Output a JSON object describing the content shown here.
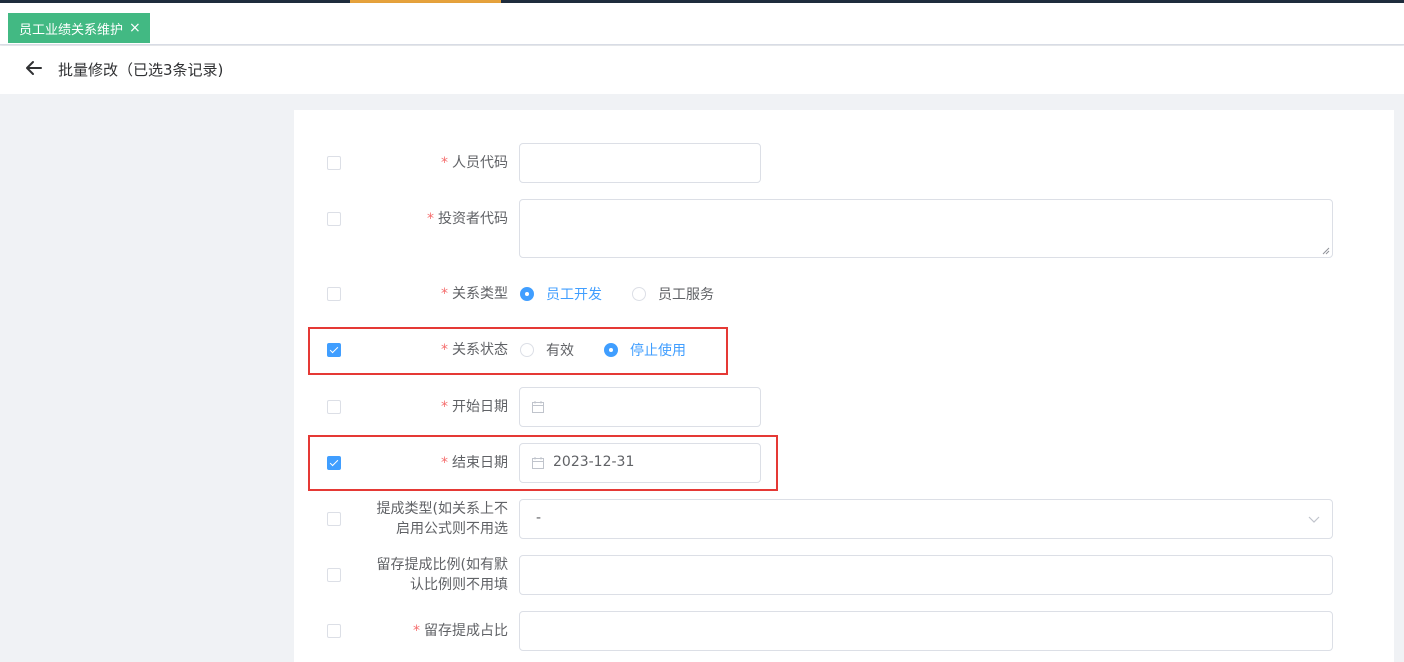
{
  "tabs": [
    {
      "label": "员工业绩关系维护",
      "close": "×"
    }
  ],
  "header": {
    "title": "批量修改（已选3条记录)"
  },
  "form": {
    "fields": [
      {
        "label": "人员代码",
        "required": "*",
        "checked": false
      },
      {
        "label": "投资者代码",
        "required": "*",
        "checked": false
      },
      {
        "label": "关系类型",
        "required": "*",
        "checked": false,
        "options": [
          "员工开发",
          "员工服务"
        ],
        "selected": "员工开发"
      },
      {
        "label": "关系状态",
        "required": "*",
        "checked": true,
        "options": [
          "有效",
          "停止使用"
        ],
        "selected": "停止使用"
      },
      {
        "label": "开始日期",
        "required": "*",
        "checked": false,
        "value": ""
      },
      {
        "label": "结束日期",
        "required": "*",
        "checked": true,
        "value": "2023-12-31"
      },
      {
        "label_line1": "提成类型(如关系上不",
        "label_line2": "启用公式则不用选",
        "checked": false,
        "value": "-"
      },
      {
        "label_line1": "留存提成比例(如有默",
        "label_line2": "认比例则不用填",
        "checked": false,
        "value": ""
      },
      {
        "label": "留存提成占比",
        "required": "*",
        "checked": false,
        "value": ""
      }
    ]
  },
  "colors": {
    "primary": "#409eff",
    "tab_active": "#42b983",
    "required": "#f56c6c",
    "highlight_box": "#e53935"
  },
  "icons": [
    "back-arrow-icon",
    "close-icon",
    "calendar-icon",
    "chevron-down-icon"
  ]
}
